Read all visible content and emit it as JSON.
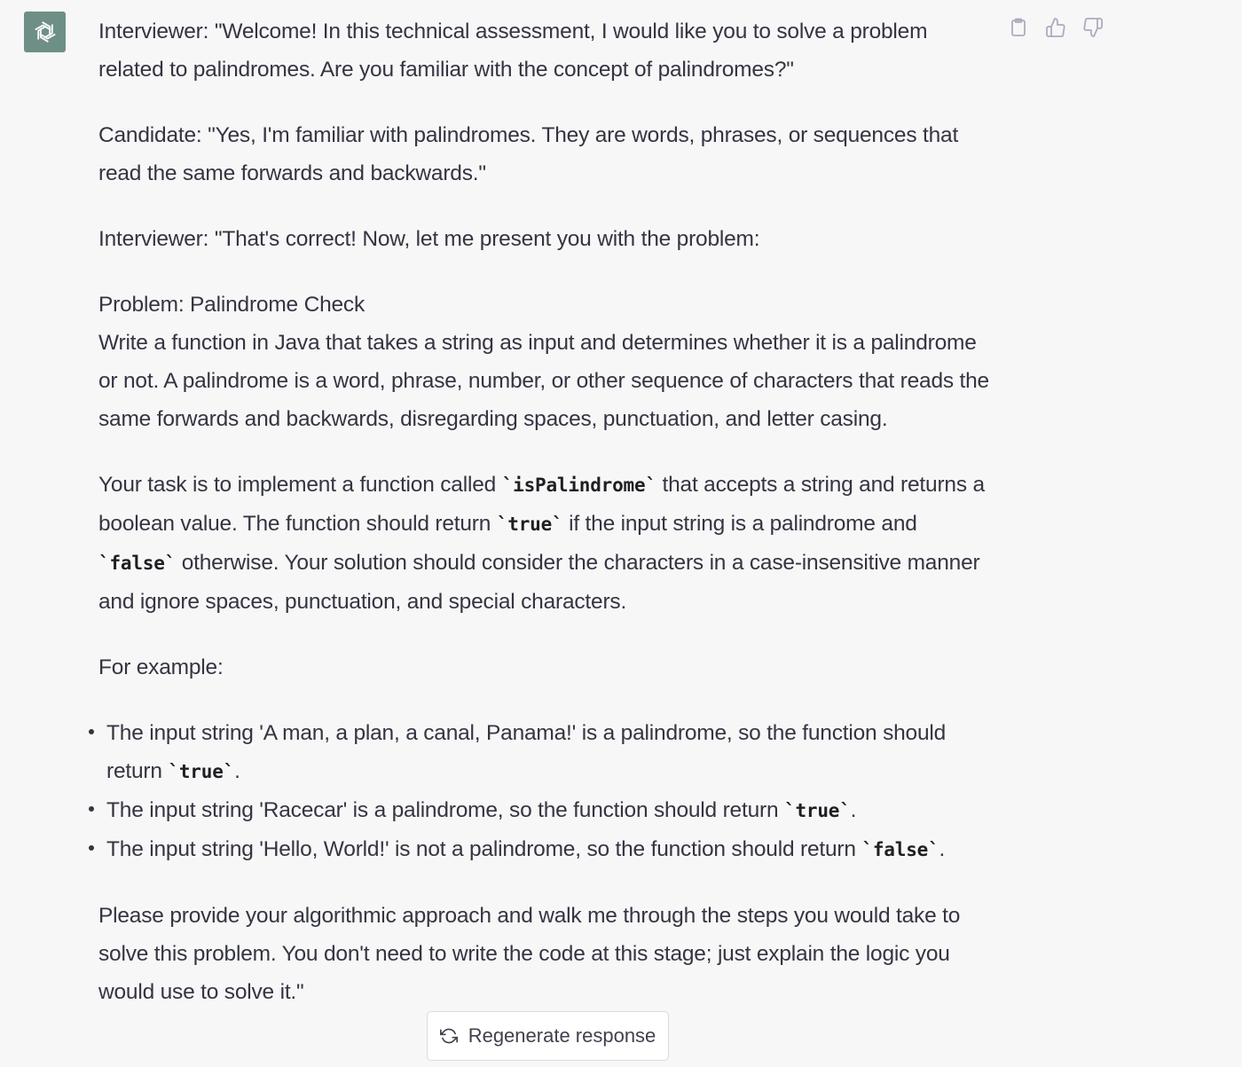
{
  "assistant": {
    "avatar_icon": "openai-logo-icon",
    "avatar_color": "#6e8f86"
  },
  "actions": {
    "copy_icon": "clipboard-icon",
    "like_icon": "thumbs-up-icon",
    "dislike_icon": "thumbs-down-icon"
  },
  "message": {
    "p1": "Interviewer: \"Welcome! In this technical assessment, I would like you to solve a problem related to palindromes. Are you familiar with the concept of palindromes?\"",
    "p2": "Candidate: \"Yes, I'm familiar with palindromes. They are words, phrases, or sequences that read the same forwards and backwards.\"",
    "p3": "Interviewer: \"That's correct! Now, let me present you with the problem:",
    "problem_title": "Problem: Palindrome Check",
    "problem_body": "Write a function in Java that takes a string as input and determines whether it is a palindrome or not. A palindrome is a word, phrase, number, or other sequence of characters that reads the same forwards and backwards, disregarding spaces, punctuation, and letter casing.",
    "task": {
      "t1": "Your task is to implement a function called ",
      "c1": "`isPalindrome`",
      "t2": " that accepts a string and returns a boolean value. The function should return ",
      "c2": "`true`",
      "t3": " if the input string is a palindrome and ",
      "c3": "`false`",
      "t4": " otherwise. Your solution should consider the characters in a case-insensitive manner and ignore spaces, punctuation, and special characters."
    },
    "for_example": "For example:",
    "examples": [
      {
        "text": "The input string 'A man, a plan, a canal, Panama!' is a palindrome, so the function should return ",
        "code": "`true`",
        "end": "."
      },
      {
        "text": "The input string 'Racecar' is a palindrome, so the function should return ",
        "code": "`true`",
        "end": "."
      },
      {
        "text": "The input string 'Hello, World!' is not a palindrome, so the function should return ",
        "code": "`false`",
        "end": "."
      }
    ],
    "closing": "Please provide your algorithmic approach and walk me through the steps you would take to solve this problem. You don't need to write the code at this stage; just explain the logic you would use to solve it.\""
  },
  "regenerate": {
    "label": "Regenerate response",
    "icon": "refresh-icon"
  }
}
